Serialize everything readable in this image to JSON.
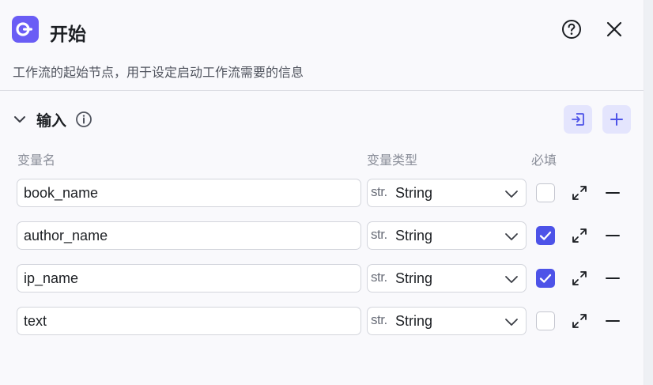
{
  "header": {
    "title": "开始",
    "description": "工作流的起始节点，用于设定启动工作流需要的信息"
  },
  "section": {
    "title": "输入",
    "columns": {
      "name": "变量名",
      "type": "变量类型",
      "required": "必填"
    }
  },
  "rows": [
    {
      "name": "book_name",
      "type_prefix": "str.",
      "type": "String",
      "required": false
    },
    {
      "name": "author_name",
      "type_prefix": "str.",
      "type": "String",
      "required": true
    },
    {
      "name": "ip_name",
      "type_prefix": "str.",
      "type": "String",
      "required": true
    },
    {
      "name": "text",
      "type_prefix": "str.",
      "type": "String",
      "required": false
    }
  ],
  "icons": {
    "node": "start-node-icon",
    "help": "help-circle-icon",
    "close": "close-icon",
    "collapse": "chevron-down-icon",
    "info": "info-icon",
    "import": "import-icon",
    "add": "plus-icon",
    "expand": "expand-icon",
    "remove": "minus-icon"
  },
  "colors": {
    "accent": "#4d53e8",
    "node_icon": "#6a5df5",
    "button_bg": "#e4e5fd"
  }
}
